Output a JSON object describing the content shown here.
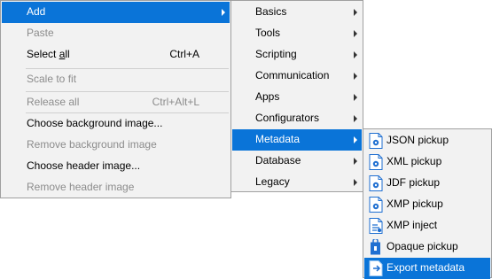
{
  "menu1": {
    "items": [
      {
        "label": "Add",
        "highlighted": true,
        "submenu": true
      },
      {
        "label": "Paste",
        "disabled": true
      },
      {
        "label_pre": "Select ",
        "label_u": "a",
        "label_post": "ll",
        "shortcut": "Ctrl+A"
      },
      {
        "label": "Scale to fit",
        "disabled": true
      },
      {
        "label": "Release all",
        "shortcut": "Ctrl+Alt+L",
        "disabled": true
      },
      {
        "label": "Choose background image..."
      },
      {
        "label": "Remove background image",
        "disabled": true
      },
      {
        "label": "Choose header image..."
      },
      {
        "label": "Remove header image",
        "disabled": true
      }
    ]
  },
  "menu2": {
    "items": [
      {
        "label": "Basics",
        "submenu": true
      },
      {
        "label": "Tools",
        "submenu": true
      },
      {
        "label": "Scripting",
        "submenu": true
      },
      {
        "label": "Communication",
        "submenu": true
      },
      {
        "label": "Apps",
        "submenu": true
      },
      {
        "label": "Configurators",
        "submenu": true
      },
      {
        "label": "Metadata",
        "submenu": true,
        "highlighted": true
      },
      {
        "label": "Database",
        "submenu": true
      },
      {
        "label": "Legacy",
        "submenu": true
      }
    ]
  },
  "menu3": {
    "items": [
      {
        "label": "JSON pickup",
        "icon": "document-gear-icon"
      },
      {
        "label": "XML pickup",
        "icon": "document-gear-icon"
      },
      {
        "label": "JDF pickup",
        "icon": "document-gear-icon"
      },
      {
        "label": "XMP pickup",
        "icon": "document-gear-icon"
      },
      {
        "label": "XMP inject",
        "icon": "document-inject-icon"
      },
      {
        "label": "Opaque pickup",
        "icon": "document-lock-icon"
      },
      {
        "label": "Export metadata",
        "icon": "document-export-icon",
        "highlighted": true
      }
    ]
  },
  "colors": {
    "highlight": "#0a74d8",
    "menu_bg": "#f2f2f2",
    "disabled_text": "#8c8c8c",
    "icon_blue": "#1f6fd1"
  }
}
